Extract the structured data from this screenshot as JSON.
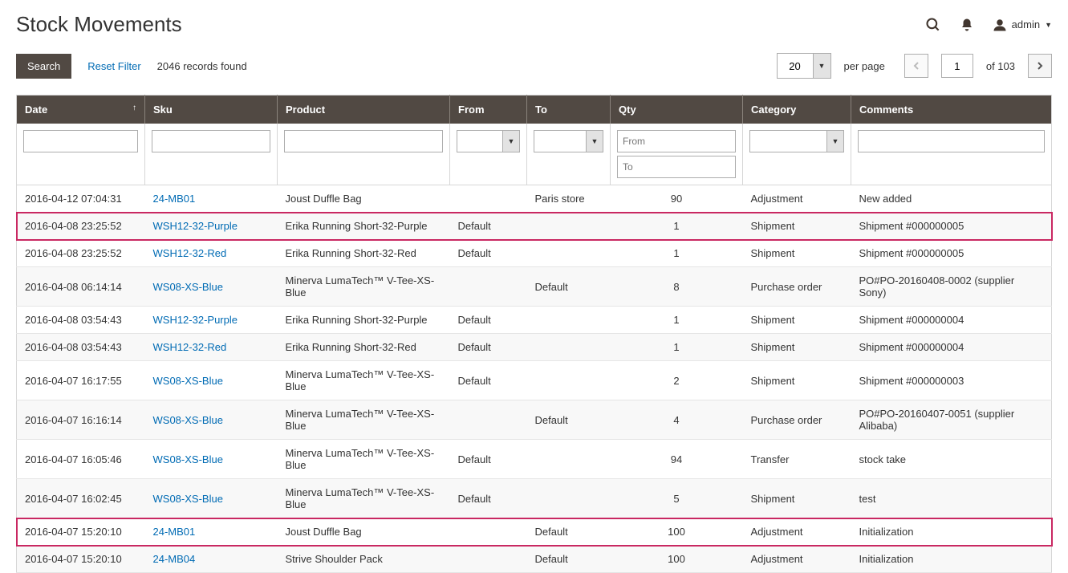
{
  "header": {
    "title": "Stock Movements",
    "user_label": "admin"
  },
  "toolbar": {
    "search_label": "Search",
    "reset_label": "Reset Filter",
    "records_found": "2046 records found",
    "per_page_value": "20",
    "per_page_label": "per page",
    "current_page": "1",
    "of_label": "of 103"
  },
  "columns": {
    "date": "Date",
    "sku": "Sku",
    "product": "Product",
    "from": "From",
    "to": "To",
    "qty": "Qty",
    "category": "Category",
    "comments": "Comments"
  },
  "filters": {
    "qty_from_placeholder": "From",
    "qty_to_placeholder": "To"
  },
  "rows": [
    {
      "date": "2016-04-12 07:04:31",
      "sku": "24-MB01",
      "product": "Joust Duffle Bag",
      "from": "",
      "to": "Paris store",
      "qty": "90",
      "category": "Adjustment",
      "comments": "New added",
      "highlighted": false
    },
    {
      "date": "2016-04-08 23:25:52",
      "sku": "WSH12-32-Purple",
      "product": "Erika Running Short-32-Purple",
      "from": "Default",
      "to": "",
      "qty": "1",
      "category": "Shipment",
      "comments": "Shipment #000000005",
      "highlighted": true
    },
    {
      "date": "2016-04-08 23:25:52",
      "sku": "WSH12-32-Red",
      "product": "Erika Running Short-32-Red",
      "from": "Default",
      "to": "",
      "qty": "1",
      "category": "Shipment",
      "comments": "Shipment #000000005",
      "highlighted": false
    },
    {
      "date": "2016-04-08 06:14:14",
      "sku": "WS08-XS-Blue",
      "product": "Minerva LumaTech™ V-Tee-XS-Blue",
      "from": "",
      "to": "Default",
      "qty": "8",
      "category": "Purchase order",
      "comments": "PO#PO-20160408-0002 (supplier Sony)",
      "highlighted": false
    },
    {
      "date": "2016-04-08 03:54:43",
      "sku": "WSH12-32-Purple",
      "product": "Erika Running Short-32-Purple",
      "from": "Default",
      "to": "",
      "qty": "1",
      "category": "Shipment",
      "comments": "Shipment #000000004",
      "highlighted": false
    },
    {
      "date": "2016-04-08 03:54:43",
      "sku": "WSH12-32-Red",
      "product": "Erika Running Short-32-Red",
      "from": "Default",
      "to": "",
      "qty": "1",
      "category": "Shipment",
      "comments": "Shipment #000000004",
      "highlighted": false
    },
    {
      "date": "2016-04-07 16:17:55",
      "sku": "WS08-XS-Blue",
      "product": "Minerva LumaTech™ V-Tee-XS-Blue",
      "from": "Default",
      "to": "",
      "qty": "2",
      "category": "Shipment",
      "comments": "Shipment #000000003",
      "highlighted": false
    },
    {
      "date": "2016-04-07 16:16:14",
      "sku": "WS08-XS-Blue",
      "product": "Minerva LumaTech™ V-Tee-XS-Blue",
      "from": "",
      "to": "Default",
      "qty": "4",
      "category": "Purchase order",
      "comments": "PO#PO-20160407-0051 (supplier Alibaba)",
      "highlighted": false
    },
    {
      "date": "2016-04-07 16:05:46",
      "sku": "WS08-XS-Blue",
      "product": "Minerva LumaTech™ V-Tee-XS-Blue",
      "from": "Default",
      "to": "",
      "qty": "94",
      "category": "Transfer",
      "comments": "stock take",
      "highlighted": false
    },
    {
      "date": "2016-04-07 16:02:45",
      "sku": "WS08-XS-Blue",
      "product": "Minerva LumaTech™ V-Tee-XS-Blue",
      "from": "Default",
      "to": "",
      "qty": "5",
      "category": "Shipment",
      "comments": "test",
      "highlighted": false
    },
    {
      "date": "2016-04-07 15:20:10",
      "sku": "24-MB01",
      "product": "Joust Duffle Bag",
      "from": "",
      "to": "Default",
      "qty": "100",
      "category": "Adjustment",
      "comments": "Initialization",
      "highlighted": true
    },
    {
      "date": "2016-04-07 15:20:10",
      "sku": "24-MB04",
      "product": "Strive Shoulder Pack",
      "from": "",
      "to": "Default",
      "qty": "100",
      "category": "Adjustment",
      "comments": "Initialization",
      "highlighted": false
    }
  ]
}
